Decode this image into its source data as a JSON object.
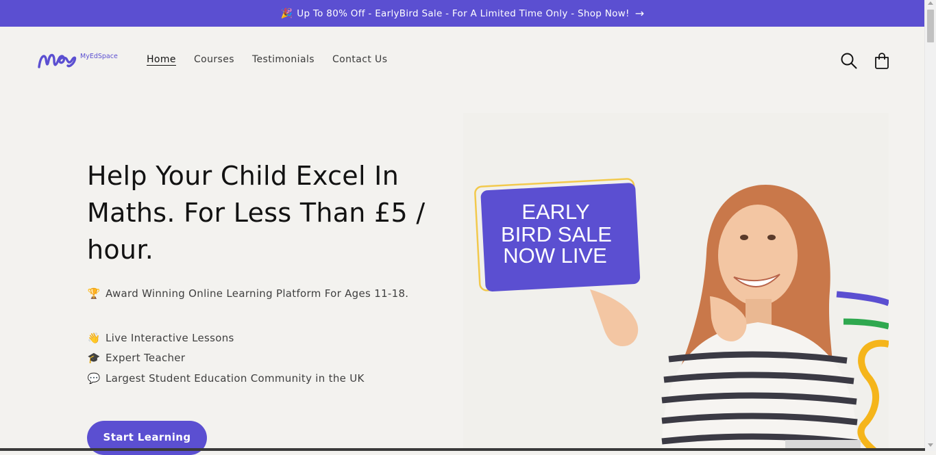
{
  "announcement": {
    "emoji": "🎉",
    "text": "Up To 80% Off - EarlyBird Sale - For A Limited Time Only - Shop Now!",
    "arrow": "→"
  },
  "header": {
    "logo_text": "MyEdSpace",
    "nav": [
      {
        "label": "Home",
        "active": true
      },
      {
        "label": "Courses"
      },
      {
        "label": "Testimonials"
      },
      {
        "label": "Contact Us"
      }
    ],
    "icons": [
      "search-icon",
      "cart-icon"
    ]
  },
  "hero": {
    "title": "Help Your Child Excel In Maths. For Less Than £5 / hour.",
    "award": {
      "icon": "🏆",
      "text": "Award Winning Online Learning Platform For Ages 11-18."
    },
    "features": [
      {
        "icon": "👋",
        "text": "Live Interactive Lessons"
      },
      {
        "icon": "🎓",
        "text": "Expert Teacher"
      },
      {
        "icon": "💬",
        "text": "Largest Student Education Community in the UK"
      }
    ],
    "cta": "Start Learning",
    "promo_badge": [
      "EARLY",
      "BIRD SALE",
      "NOW LIVE"
    ]
  },
  "colors": {
    "brand": "#5b4fd1",
    "background": "#f3f2ef",
    "badge_border": "#f2c94c",
    "stripe_green": "#2fa84f",
    "stripe_yellow": "#f5b51b"
  }
}
